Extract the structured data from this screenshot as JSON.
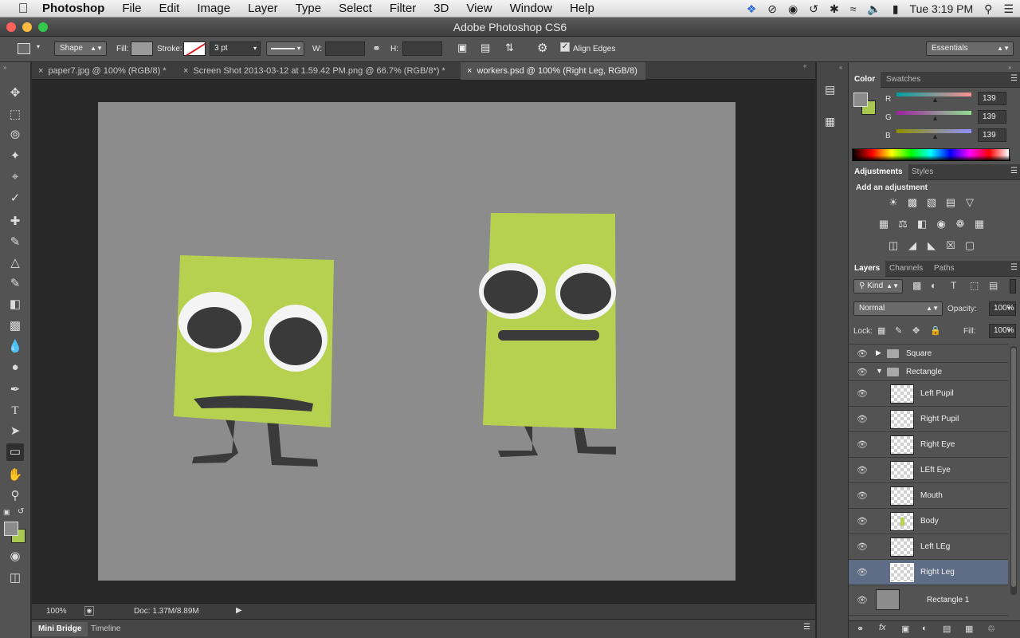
{
  "menubar": {
    "app": "Photoshop",
    "items": [
      "File",
      "Edit",
      "Image",
      "Layer",
      "Type",
      "Select",
      "Filter",
      "3D",
      "View",
      "Window",
      "Help"
    ],
    "clock": "Tue 3:19 PM"
  },
  "window": {
    "title": "Adobe Photoshop CS6"
  },
  "options": {
    "mode": "Shape",
    "fill_label": "Fill:",
    "stroke_label": "Stroke:",
    "stroke_width": "3 pt",
    "w_label": "W:",
    "h_label": "H:",
    "align_edges": "Align Edges",
    "workspace": "Essentials"
  },
  "doc_tabs": [
    {
      "label": "paper7.jpg @ 100% (RGB/8) *"
    },
    {
      "label": "Screen Shot 2013-03-12 at 1.59.42 PM.png @ 66.7% (RGB/8*) *"
    },
    {
      "label": "workers.psd @ 100% (Right Leg, RGB/8)"
    }
  ],
  "status": {
    "zoom": "100%",
    "doc": "Doc: 1.37M/8.89M"
  },
  "bottom_tabs": {
    "mini_bridge": "Mini Bridge",
    "timeline": "Timeline"
  },
  "color_panel": {
    "tabs": {
      "color": "Color",
      "swatches": "Swatches"
    },
    "r_label": "R",
    "g_label": "G",
    "b_label": "B",
    "r": "139",
    "g": "139",
    "b": "139",
    "foreground": "#8b8b8b",
    "background": "#a8c850"
  },
  "adjustments_panel": {
    "tabs": {
      "adjustments": "Adjustments",
      "styles": "Styles"
    },
    "heading": "Add an adjustment"
  },
  "layers_panel": {
    "tabs": {
      "layers": "Layers",
      "channels": "Channels",
      "paths": "Paths"
    },
    "kind": "Kind",
    "blend_mode": "Normal",
    "opacity_label": "Opacity:",
    "opacity": "100%",
    "lock_label": "Lock:",
    "fill_label": "Fill:",
    "fill": "100%",
    "groups": {
      "square": "Square",
      "rectangle": "Rectangle"
    },
    "layers": [
      "Left Pupil",
      "Right Pupil",
      "Right Eye",
      "LEft Eye",
      "Mouth",
      "Body",
      "Left LEg",
      "Right Leg"
    ],
    "background_layer": "Rectangle 1",
    "selected": "Right Leg"
  }
}
